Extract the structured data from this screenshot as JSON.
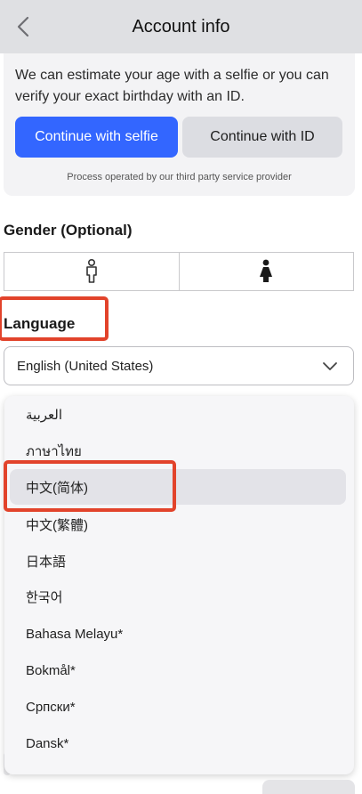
{
  "header": {
    "title": "Account info",
    "back_icon": "chevron-left-icon"
  },
  "age_verification": {
    "description": "We can estimate your age with a selfie or you can verify your exact birthday with an ID.",
    "selfie_button": "Continue with selfie",
    "id_button": "Continue with ID",
    "provider_note": "Process operated by our third party service provider"
  },
  "gender": {
    "label": "Gender (Optional)",
    "options": [
      {
        "icon": "male-outline-icon"
      },
      {
        "icon": "female-filled-icon"
      }
    ]
  },
  "language": {
    "label": "Language",
    "selected_value": "English (United States)",
    "options": [
      "العربية",
      "ภาษาไทย",
      "中文(简体)",
      "中文(繁體)",
      "日本語",
      "한국어",
      "Bahasa Melayu*",
      "Bokmål*",
      "Српски*",
      "Dansk*"
    ],
    "highlighted_index": 2
  },
  "colors": {
    "primary": "#3366ff",
    "annotation": "#e2432b",
    "header_bg": "#dfe0e3"
  }
}
